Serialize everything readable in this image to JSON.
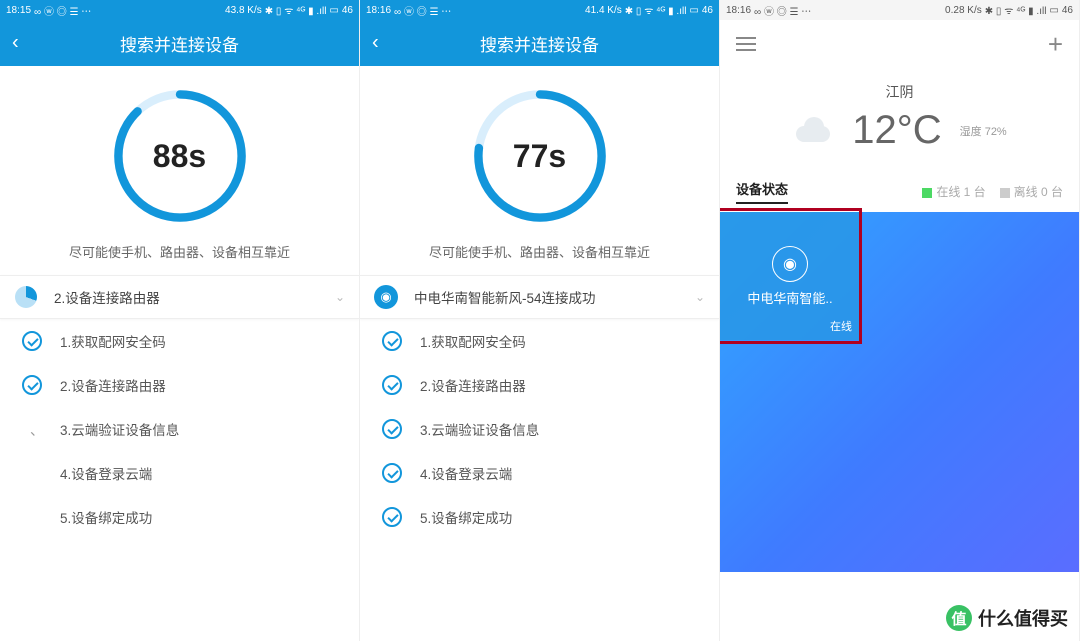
{
  "panel1": {
    "status": {
      "time": "18:15",
      "speed": "43.8 K/s",
      "battery": "46"
    },
    "title": "搜索并连接设备",
    "count": "88s",
    "hint": "尽可能使手机、路由器、设备相互靠近",
    "current": "2.设备连接路由器",
    "steps": [
      {
        "label": "1.获取配网安全码",
        "done": true
      },
      {
        "label": "2.设备连接路由器",
        "done": true
      },
      {
        "label": "3.云端验证设备信息",
        "done": false
      },
      {
        "label": "4.设备登录云端",
        "done": false
      },
      {
        "label": "5.设备绑定成功",
        "done": false
      }
    ]
  },
  "panel2": {
    "status": {
      "time": "18:16",
      "speed": "41.4 K/s",
      "battery": "46"
    },
    "title": "搜索并连接设备",
    "count": "77s",
    "hint": "尽可能使手机、路由器、设备相互靠近",
    "current": "中电华南智能新风-54连接成功",
    "steps": [
      {
        "label": "1.获取配网安全码",
        "done": true
      },
      {
        "label": "2.设备连接路由器",
        "done": true
      },
      {
        "label": "3.云端验证设备信息",
        "done": true
      },
      {
        "label": "4.设备登录云端",
        "done": true
      },
      {
        "label": "5.设备绑定成功",
        "done": true
      }
    ]
  },
  "panel3": {
    "status": {
      "time": "18:16",
      "speed": "0.28 K/s",
      "battery": "46"
    },
    "city": "江阴",
    "temp": "12°C",
    "humidity": "湿度 72%",
    "section": "设备状态",
    "onlineLabel": "在线 1 台",
    "offlineLabel": "离线 0 台",
    "card": {
      "name": "中电华南智能..",
      "status": "在线"
    }
  },
  "watermark": "什么值得买"
}
